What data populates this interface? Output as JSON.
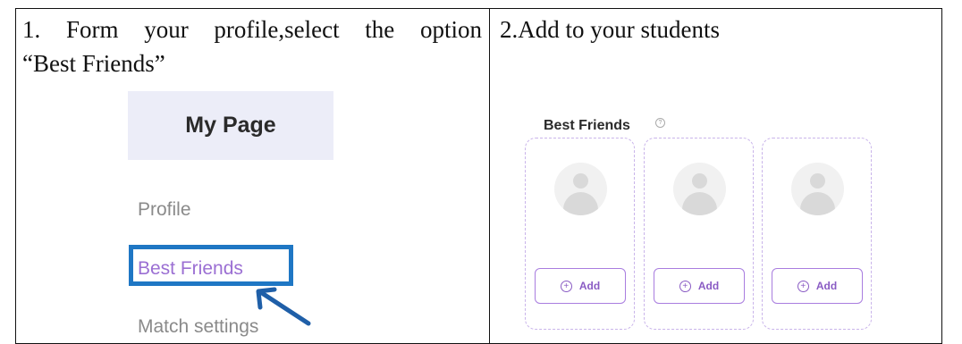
{
  "step1": {
    "line1": "1. Form your profile,select the option",
    "line2": "“Best Friends”"
  },
  "step2": {
    "line1": "2.Add to your students"
  },
  "left_screenshot": {
    "header": "My Page",
    "menu": [
      "Profile",
      "Best Friends",
      "Match settings"
    ],
    "highlight_color": "#1f77c4",
    "active_color": "#9b6fd3"
  },
  "right_screenshot": {
    "title": "Best Friends",
    "info_icon": "?",
    "cards": [
      {
        "add_icon": "+",
        "add_label": "Add"
      },
      {
        "add_icon": "+",
        "add_label": "Add"
      },
      {
        "add_icon": "+",
        "add_label": "Add"
      }
    ],
    "accent_color": "#a97ddf"
  }
}
